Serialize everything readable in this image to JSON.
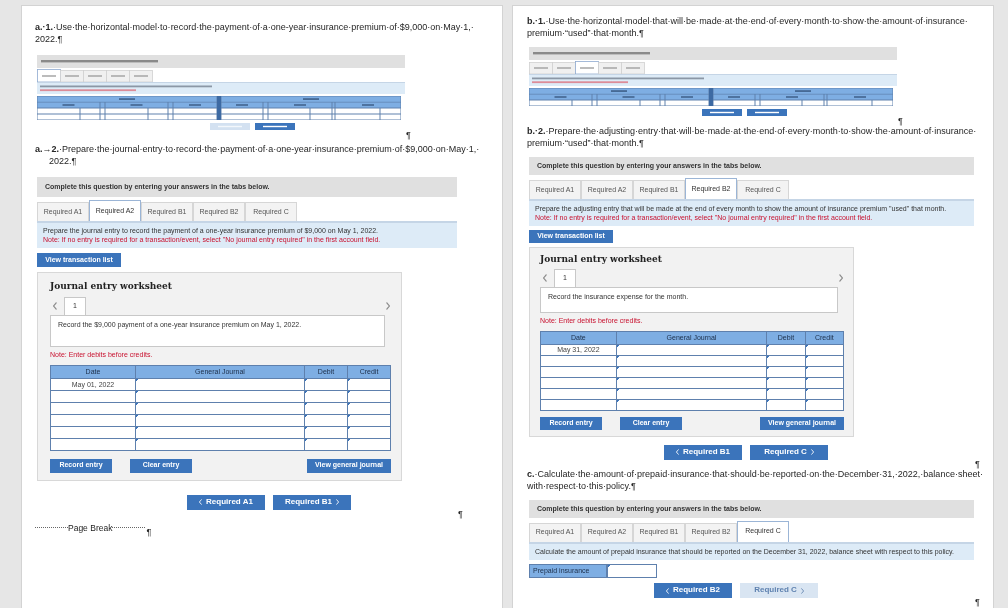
{
  "pages": [
    {
      "blocks": [
        {
          "kind": "question",
          "text": "**a.·1.**·Use·the·horizontal·model·to·record·the·payment·of·a·one-year·insurance·premium·of·$9,000·on·May·1,·2022.¶"
        },
        {
          "kind": "form_thumbnail",
          "tabs": [
            {
              "selected": true
            },
            {
              "selected": false
            },
            {
              "selected": false
            },
            {
              "selected": false
            },
            {
              "selected": false
            }
          ],
          "rows": [
            {},
            {}
          ],
          "nav": [
            {
              "kind": "previous",
              "disabled": true
            },
            {
              "kind": "next",
              "disabled": false
            }
          ],
          "paragraph_mark": "¶"
        },
        {
          "kind": "question",
          "text": "**a.→2.**·Prepare·the·journal·entry·to·record·the·payment·of·a·one-year·insurance·premium·of·$9,000·on·May·1,·2022.¶"
        },
        {
          "kind": "journal_entry",
          "banner": "Complete this question by entering your answers in the tabs below.",
          "tabs": [
            {
              "label": "Required A1",
              "selected": false
            },
            {
              "label": "Required A2",
              "selected": true
            },
            {
              "label": "Required B1",
              "selected": false
            },
            {
              "label": "Required B2",
              "selected": false
            },
            {
              "label": "Required C",
              "selected": false
            }
          ],
          "instruction": "Prepare the journal entry to record the payment of a one-year insurance premium of $9,000 on May 1, 2022.",
          "note": "Note: If no entry is required for a transaction/event, select \"No journal entry required\" in the first account field.",
          "view_button": "View transaction list",
          "worksheet": {
            "title": "Journal entry worksheet",
            "entries": [
              {
                "label": "1",
                "selected": true
              }
            ],
            "description": "Record the $9,000 payment of a one-year insurance premium on May 1, 2022.",
            "note": "Note: Enter debits before credits.",
            "columns": [
              "Date",
              "General Journal",
              "Debit",
              "Credit"
            ],
            "rows": [
              {
                "date": "May 01, 2022"
              },
              {},
              {},
              {},
              {},
              {}
            ],
            "buttons": [
              "Record entry",
              "Clear entry",
              "View general journal"
            ]
          },
          "nav": [
            {
              "kind": "previous",
              "label": "Required A1",
              "disabled": false
            },
            {
              "kind": "next",
              "label": "Required B1",
              "disabled": false
            }
          ],
          "paragraph_mark": "¶"
        },
        {
          "kind": "page_break",
          "label": "Page Break",
          "paragraph_mark": "¶"
        }
      ]
    },
    {
      "blocks": [
        {
          "kind": "question",
          "text": "**b.·1.**·Use·the·horizontal·model·that·will·be·made·at·the·end·of·every·month·to·show·the·amount·of·insurance·premium·“used”·that·month.¶"
        },
        {
          "kind": "form_thumbnail",
          "tabs": [
            {
              "selected": false
            },
            {
              "selected": false
            },
            {
              "selected": true
            },
            {
              "selected": false
            },
            {
              "selected": false
            }
          ],
          "rows": [
            {}
          ],
          "nav": [
            {
              "kind": "previous",
              "disabled": false
            },
            {
              "kind": "next",
              "disabled": false
            }
          ],
          "paragraph_mark": "¶"
        },
        {
          "kind": "question",
          "text": "**b.·2.**·Prepare·the·adjusting·entry·that·will·be·made·at·the·end·of·every·month·to·show·the·amount·of·insurance·premium·“used”·that·month.¶"
        },
        {
          "kind": "journal_entry",
          "banner": "Complete this question by entering your answers in the tabs below.",
          "tabs": [
            {
              "label": "Required A1",
              "selected": false
            },
            {
              "label": "Required A2",
              "selected": false
            },
            {
              "label": "Required B1",
              "selected": false
            },
            {
              "label": "Required B2",
              "selected": true
            },
            {
              "label": "Required C",
              "selected": false
            }
          ],
          "instruction": "Prepare the adjusting entry that will be made at the end of every month to show the amount of insurance premium \"used\" that month.",
          "note": "Note: If no entry is required for a transaction/event, select \"No journal entry required\" in the first account field.",
          "view_button": "View transaction list",
          "worksheet": {
            "title": "Journal entry worksheet",
            "entries": [
              {
                "label": "1",
                "selected": true
              }
            ],
            "description": "Record the insurance expense for the month.",
            "note": "Note: Enter debits before credits.",
            "columns": [
              "Date",
              "General Journal",
              "Debit",
              "Credit"
            ],
            "rows": [
              {
                "date": "May 31, 2022"
              },
              {},
              {},
              {},
              {},
              {}
            ],
            "buttons": [
              "Record entry",
              "Clear entry",
              "View general journal"
            ]
          },
          "nav": [
            {
              "kind": "previous",
              "label": "Required B1",
              "disabled": false
            },
            {
              "kind": "next",
              "label": "Required C",
              "disabled": false
            }
          ],
          "paragraph_mark": "¶"
        },
        {
          "kind": "question",
          "text": "**c.**·Calculate·the·amount·of·prepaid·insurance·that·should·be·reported·on·the·December·31,·2022,·balance·sheet·with·respect·to·this·policy.¶"
        },
        {
          "kind": "amount_field",
          "banner": "Complete this question by entering your answers in the tabs below.",
          "tabs": [
            {
              "label": "Required A1",
              "selected": false
            },
            {
              "label": "Required A2",
              "selected": false
            },
            {
              "label": "Required B1",
              "selected": false
            },
            {
              "label": "Required B2",
              "selected": false
            },
            {
              "label": "Required C",
              "selected": true
            }
          ],
          "instruction": "Calculate the amount of prepaid insurance that should be reported on the December 31, 2022, balance sheet with respect to this policy.",
          "field": {
            "label": "Prepaid insurance"
          },
          "nav": [
            {
              "kind": "previous",
              "label": "Required B2",
              "disabled": false
            },
            {
              "kind": "next",
              "label": "Required C",
              "disabled": true
            }
          ],
          "paragraph_mark": "¶"
        }
      ]
    }
  ]
}
